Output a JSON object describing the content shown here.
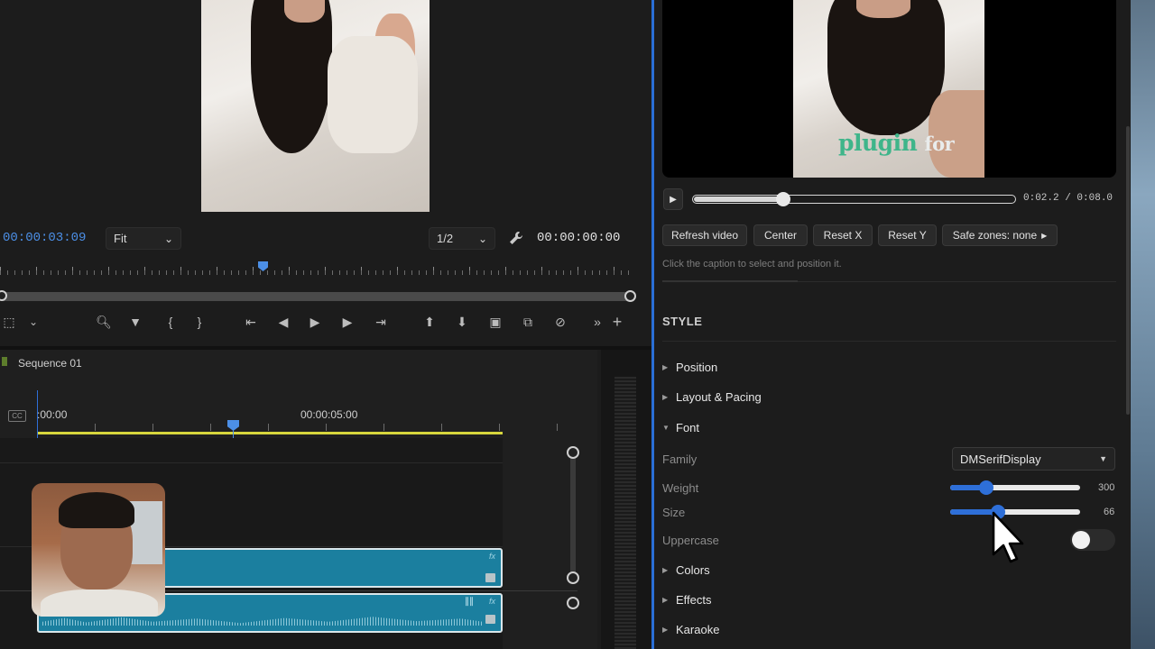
{
  "program_monitor": {
    "timecode_current": "00:00:03:09",
    "zoom_select": "Fit",
    "resolution_select": "1/2",
    "timecode_duration": "00:00:00:00"
  },
  "timeline": {
    "sequence_name": "Sequence 01",
    "ruler_start": ":00:00",
    "ruler_mark": "00:00:05:00"
  },
  "plugin": {
    "preview_caption": {
      "word1": "plugin",
      "word2": "for"
    },
    "player": {
      "time": "0:02.2 / 0:08.0",
      "progress": 0.28
    },
    "buttons": {
      "refresh": "Refresh video",
      "center": "Center",
      "reset_x": "Reset X",
      "reset_y": "Reset Y",
      "safe_zones": "Safe zones: none"
    },
    "hint": "Click the caption to select and position it.",
    "style_heading": "STYLE",
    "sections": {
      "position": "Position",
      "layout": "Layout & Pacing",
      "font": "Font",
      "colors": "Colors",
      "effects": "Effects",
      "karaoke": "Karaoke"
    },
    "font": {
      "family_label": "Family",
      "family_value": "DMSerifDisplay",
      "weight_label": "Weight",
      "weight_value": "300",
      "weight_fraction": 0.28,
      "size_label": "Size",
      "size_value": "66",
      "size_fraction": 0.37,
      "uppercase_label": "Uppercase",
      "uppercase_on": false
    }
  },
  "colors": {
    "accent": "#2e6fd8",
    "caption_green": "#3fb58a",
    "clip_teal": "#1b7f9f",
    "timecode_blue": "#4c8fe6"
  }
}
